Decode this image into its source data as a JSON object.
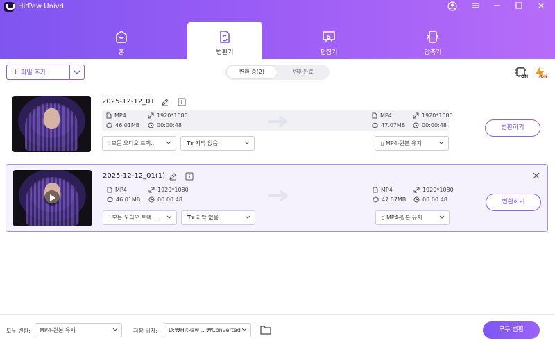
{
  "app": {
    "title": "HitPaw Univd"
  },
  "nav": [
    {
      "label": "홈",
      "icon": "home-icon"
    },
    {
      "label": "변환기",
      "icon": "converter-icon",
      "active": true
    },
    {
      "label": "편집기",
      "icon": "editor-icon"
    },
    {
      "label": "압축기",
      "icon": "compressor-icon"
    }
  ],
  "toolbar": {
    "add_file": "파일 추가",
    "tab_converting": "변환 중(2)",
    "tab_converted": "변환완료",
    "hw_accel_badge": "ON",
    "speed_badge": "ON"
  },
  "files": [
    {
      "name": "2025-12-12_01",
      "src": {
        "format": "MP4",
        "resolution": "1920*1080",
        "size": "46.01MB",
        "duration": "00:00:48"
      },
      "dst": {
        "format": "MP4",
        "resolution": "1920*1080",
        "size": "47.07MB",
        "duration": "00:00:48"
      },
      "audio": "모든 오디오 트랙...",
      "subtitle": "자막 없음",
      "output": "MP4-원본 유지",
      "convert": "변환하기"
    },
    {
      "name": "2025-12-12_01(1)",
      "src": {
        "format": "MP4",
        "resolution": "1920*1080",
        "size": "46.01MB",
        "duration": "00:00:48"
      },
      "dst": {
        "format": "MP4",
        "resolution": "1920*1080",
        "size": "47.07MB",
        "duration": "00:00:48"
      },
      "audio": "모든 오디오 트랙...",
      "subtitle": "자막 없음",
      "output": "MP4-원본 유지",
      "convert": "변환하기"
    }
  ],
  "footer": {
    "convert_all_label": "모두 변환:",
    "convert_all_value": "MP4-원본 유지",
    "save_label": "저장 위치:",
    "save_path": "D:₩HitPaw ...₩Converted",
    "convert_all_button": "모두 변환"
  },
  "colors": {
    "accent": "#7b4ff0",
    "header_start": "#7f55f0",
    "header_end": "#b66cf8"
  }
}
